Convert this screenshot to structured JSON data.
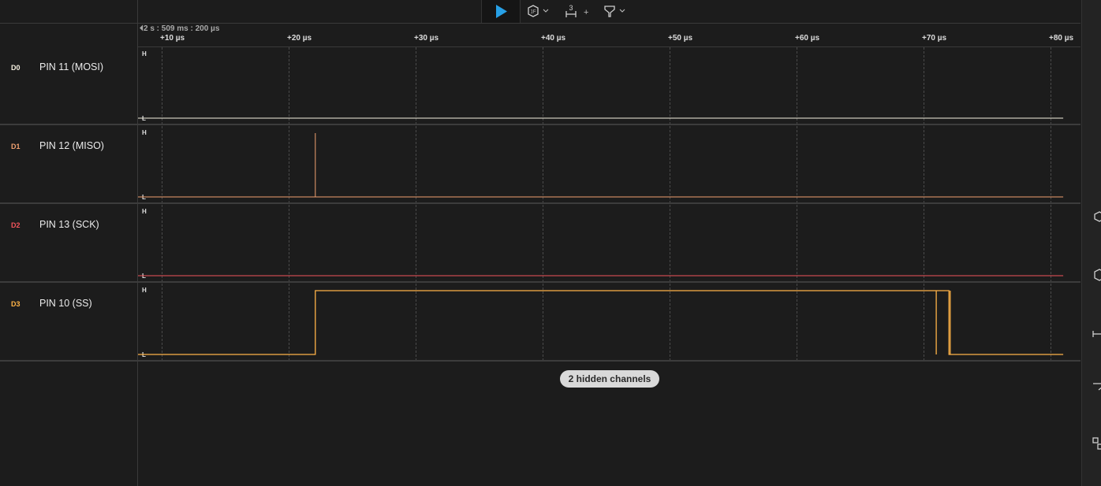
{
  "toolbar": {
    "play_icon": "play-icon",
    "measure_icon": "measure-hexagon-icon",
    "timing_marker_label": "3",
    "timing_marker_plus": "+",
    "filter_icon": "filter-funnel-icon",
    "chevron": "⌄"
  },
  "timeline": {
    "timebase": "⏴2 s : 509 ms : 200 µs",
    "ticks": [
      "+10 µs",
      "+20 µs",
      "+30 µs",
      "+40 µs",
      "+50 µs",
      "+60 µs",
      "+70 µs",
      "+80 µs"
    ]
  },
  "channels": [
    {
      "id": "D0",
      "name": "PIN 11 (MOSI)",
      "color": "#f5f0e0",
      "high": "H",
      "low": "L"
    },
    {
      "id": "D1",
      "name": "PIN 12 (MISO)",
      "color": "#f0a070",
      "high": "H",
      "low": "L"
    },
    {
      "id": "D2",
      "name": "PIN 13 (SCK)",
      "color": "#f2545b",
      "high": "H",
      "low": "L"
    },
    {
      "id": "D3",
      "name": "PIN 10 (SS)",
      "color": "#ffb347",
      "high": "H",
      "low": "L"
    }
  ],
  "hidden_channels_label": "2 hidden channels",
  "signals": {
    "unit": "µs",
    "D0": [
      [
        5.5,
        0
      ],
      [
        81,
        0
      ]
    ],
    "D1": [
      [
        5.5,
        0
      ],
      [
        22.1,
        0
      ],
      [
        22.1,
        1
      ],
      [
        22.1,
        0
      ],
      [
        81,
        0
      ]
    ],
    "D2": [
      [
        5.5,
        0
      ],
      [
        81,
        0
      ]
    ],
    "D3": [
      [
        5.5,
        0
      ],
      [
        22.1,
        0
      ],
      [
        22.1,
        1
      ],
      [
        71.0,
        1
      ],
      [
        71.0,
        0
      ],
      [
        71.0,
        1
      ],
      [
        72.0,
        1
      ],
      [
        72.0,
        0
      ],
      [
        72.1,
        0
      ],
      [
        72.1,
        1
      ],
      [
        72.1,
        0
      ],
      [
        81,
        0
      ]
    ]
  },
  "right_panel_icons": [
    "analyzers-icon",
    "measurements-icon",
    "timing-markers-icon",
    "filter-icon",
    "extensions-icon"
  ]
}
